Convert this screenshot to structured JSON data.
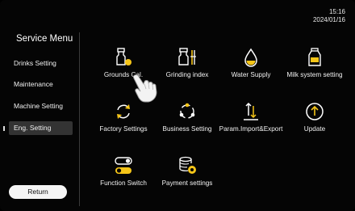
{
  "status": {
    "time": "15:16",
    "date": "2024/01/16"
  },
  "sidebar": {
    "title": "Service Menu",
    "items": [
      {
        "label": "Drinks Setting"
      },
      {
        "label": "Maintenance"
      },
      {
        "label": "Machine Setting"
      },
      {
        "label": "Eng. Setting"
      }
    ],
    "return_label": "Return"
  },
  "grid": {
    "items": [
      {
        "label": "Grounds Cal.",
        "icon": "grounds-calibration-icon"
      },
      {
        "label": "Grinding index",
        "icon": "grinding-index-icon"
      },
      {
        "label": "Water Supply",
        "icon": "water-drop-icon"
      },
      {
        "label": "Milk system setting",
        "icon": "milk-carton-icon"
      },
      {
        "label": "Factory Settings",
        "icon": "reset-arrows-icon"
      },
      {
        "label": "Business Setting",
        "icon": "business-cycle-icon"
      },
      {
        "label": "Param.Import&Export",
        "icon": "import-export-icon"
      },
      {
        "label": "Update",
        "icon": "update-arrow-icon"
      },
      {
        "label": "Function Switch",
        "icon": "toggle-switch-icon"
      },
      {
        "label": "Payment settings",
        "icon": "payment-coins-icon"
      }
    ]
  },
  "colors": {
    "background": "#050505",
    "icon_accent": "#f5c518",
    "active_bg": "#333333"
  }
}
